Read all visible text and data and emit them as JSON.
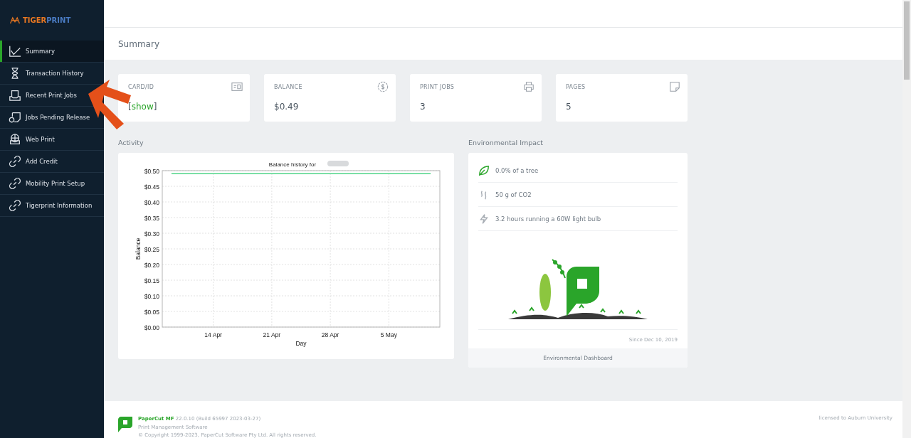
{
  "logo": {
    "part_1": "TIGER",
    "part_2": "PRINT"
  },
  "sidebar": {
    "items": [
      {
        "label": "Summary",
        "selected": true
      },
      {
        "label": "Transaction History",
        "selected": false
      },
      {
        "label": "Recent Print Jobs",
        "selected": false
      },
      {
        "label": "Jobs Pending Release",
        "selected": false
      },
      {
        "label": "Web Print",
        "selected": false
      },
      {
        "label": "Add Credit",
        "selected": false
      },
      {
        "label": "Mobility Print Setup",
        "selected": false
      },
      {
        "label": "Tigerprint Information",
        "selected": false
      }
    ]
  },
  "page_title": "Summary",
  "stats": [
    {
      "label": "CARD/ID",
      "kind": "link",
      "bracket_open": "[",
      "value": "show",
      "bracket_close": "]"
    },
    {
      "label": "BALANCE",
      "kind": "text",
      "value": "$0.49"
    },
    {
      "label": "PRINT JOBS",
      "kind": "text",
      "value": "3"
    },
    {
      "label": "PAGES",
      "kind": "text",
      "value": "5"
    }
  ],
  "activity": {
    "heading": "Activity",
    "chart_data": {
      "type": "line",
      "title": "Balance history for",
      "xlabel": "Day",
      "ylabel": "Balance",
      "categories": [
        null,
        null,
        null,
        null,
        null,
        "14 Apr",
        null,
        null,
        null,
        null,
        null,
        null,
        "21 Apr",
        null,
        null,
        null,
        null,
        null,
        null,
        "28 Apr",
        null,
        null,
        null,
        null,
        null,
        null,
        "5 May",
        null,
        null,
        null,
        null,
        null
      ],
      "ylim": [
        0,
        0.5
      ],
      "grid": true,
      "yticks": [
        {
          "value": 0,
          "label": "$0.00"
        },
        {
          "value": 0.05,
          "label": "$0.05"
        },
        {
          "value": 0.1,
          "label": "$0.10"
        },
        {
          "value": 0.15,
          "label": "$0.15"
        },
        {
          "value": 0.2,
          "label": "$0.20"
        },
        {
          "value": 0.25,
          "label": "$0.25"
        },
        {
          "value": 0.3,
          "label": "$0.30"
        },
        {
          "value": 0.35,
          "label": "$0.35"
        },
        {
          "value": 0.4,
          "label": "$0.40"
        },
        {
          "value": 0.45,
          "label": "$0.45"
        },
        {
          "value": 0.5,
          "label": "$0.50"
        }
      ],
      "series": [
        {
          "color": "#2ecc71",
          "values": [
            0.49,
            0.49,
            0.49,
            0.49,
            0.49,
            0.49,
            0.49,
            0.49,
            0.49,
            0.49,
            0.49,
            0.49,
            0.49,
            0.49,
            0.49,
            0.49,
            0.49,
            0.49,
            0.49,
            0.49,
            0.49,
            0.49,
            0.49,
            0.49,
            0.49,
            0.49,
            0.49,
            0.49,
            0.49,
            0.49,
            0.49,
            0.49
          ]
        }
      ]
    }
  },
  "environment": {
    "heading": "Environmental Impact",
    "items": [
      {
        "text": "0.0% of a tree"
      },
      {
        "text": "50 g of CO2"
      },
      {
        "text": "3.2 hours running a 60W light bulb"
      }
    ],
    "since": "Since Dec 10, 2019",
    "footer_link": "Environmental Dashboard"
  },
  "footer": {
    "product": "PaperCut MF",
    "version": "22.0.10 (Build 65997 2023-03-27)",
    "subtitle": "Print Management Software",
    "copyright": "© Copyright 1999-2023, PaperCut Software Pty Ltd. All rights reserved.",
    "license": "licensed to Auburn University"
  }
}
